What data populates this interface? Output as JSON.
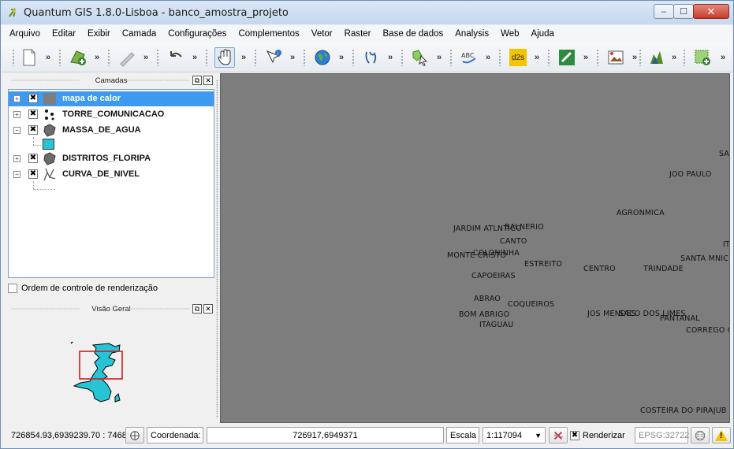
{
  "window": {
    "title": "Quantum GIS 1.8.0-Lisboa - banco_amostra_projeto",
    "controls": {
      "minimize": "‒",
      "maximize": "☐",
      "close": "✕"
    }
  },
  "menubar": {
    "items": [
      "Arquivo",
      "Editar",
      "Exibir",
      "Camada",
      "Configurações",
      "Complementos",
      "Vetor",
      "Raster",
      "Base de dados",
      "Analysis",
      "Web",
      "Ajuda"
    ]
  },
  "toolbar": {
    "chevron": "»",
    "icons": [
      "new-project-icon",
      "add-layer-icon",
      "edit-pencil-icon",
      "undo-icon",
      "pan-hand-icon",
      "identify-icon",
      "globe-icon",
      "digitize-icon",
      "select-icon",
      "spellcheck-icon",
      "d2s-icon",
      "python-icon",
      "image-icon",
      "plugin-icon",
      "add-plugin-icon"
    ],
    "d2s_label": "d2s"
  },
  "layers_dock": {
    "title": "Camadas",
    "float_btn": "⧉",
    "close_btn": "✕",
    "layers": [
      {
        "name": "mapa de calor",
        "expander": "+",
        "checked": "✖",
        "selected": true,
        "icon": "raster-layer-icon"
      },
      {
        "name": "TORRE_COMUNICACAO",
        "expander": "+",
        "checked": "✖",
        "icon": "point-layer-icon"
      },
      {
        "name": "MASSA_DE_AGUA",
        "expander": "−",
        "checked": "✖",
        "icon": "polygon-layer-icon",
        "legend_color": "#27c4d6"
      },
      {
        "name": "DISTRITOS_FLORIPA",
        "expander": "+",
        "checked": "✖",
        "icon": "polygon-layer-icon"
      },
      {
        "name": "CURVA_DE_NIVEL",
        "expander": "−",
        "checked": "✖",
        "icon": "line-layer-icon"
      }
    ],
    "render_order_label": "Ordem de controle de renderização"
  },
  "overview_dock": {
    "title": "Visão Geral",
    "float_btn": "⧉",
    "close_btn": "✕",
    "island_color": "#27c4d6",
    "extent_color": "#d21b1b"
  },
  "map": {
    "background": "#7d7d7d",
    "labels": [
      "SA",
      "JOO PAULO",
      "AGRONMICA",
      "JARDIM ATLNTICO",
      "BALNERIO",
      "CANTO",
      "IT",
      "COLONINHA",
      "MONTE CRISTO",
      "SANTA MNIC",
      "ESTREITO",
      "CENTRO",
      "TRINDADE",
      "CAPOEIRAS",
      "ABRAO",
      "COQUEIROS",
      "BOM ABRIGO",
      "JOS MENDES",
      "SACO DOS LIMES",
      "PANTANAL",
      "ITAGUAU",
      "CORREGO G",
      "COSTEIRA DO PIRAJUB"
    ]
  },
  "statusbar": {
    "coords_readout": "726854.93,6939239.70 : 7468",
    "coordinate_label": "Coordenada:",
    "coordinate_value": "726917,6949371",
    "scale_label": "Escala",
    "scale_value": "1:117094",
    "render_checked": "✖",
    "render_label": "Renderizar",
    "crs": "EPSG:32722",
    "warning": "!"
  }
}
